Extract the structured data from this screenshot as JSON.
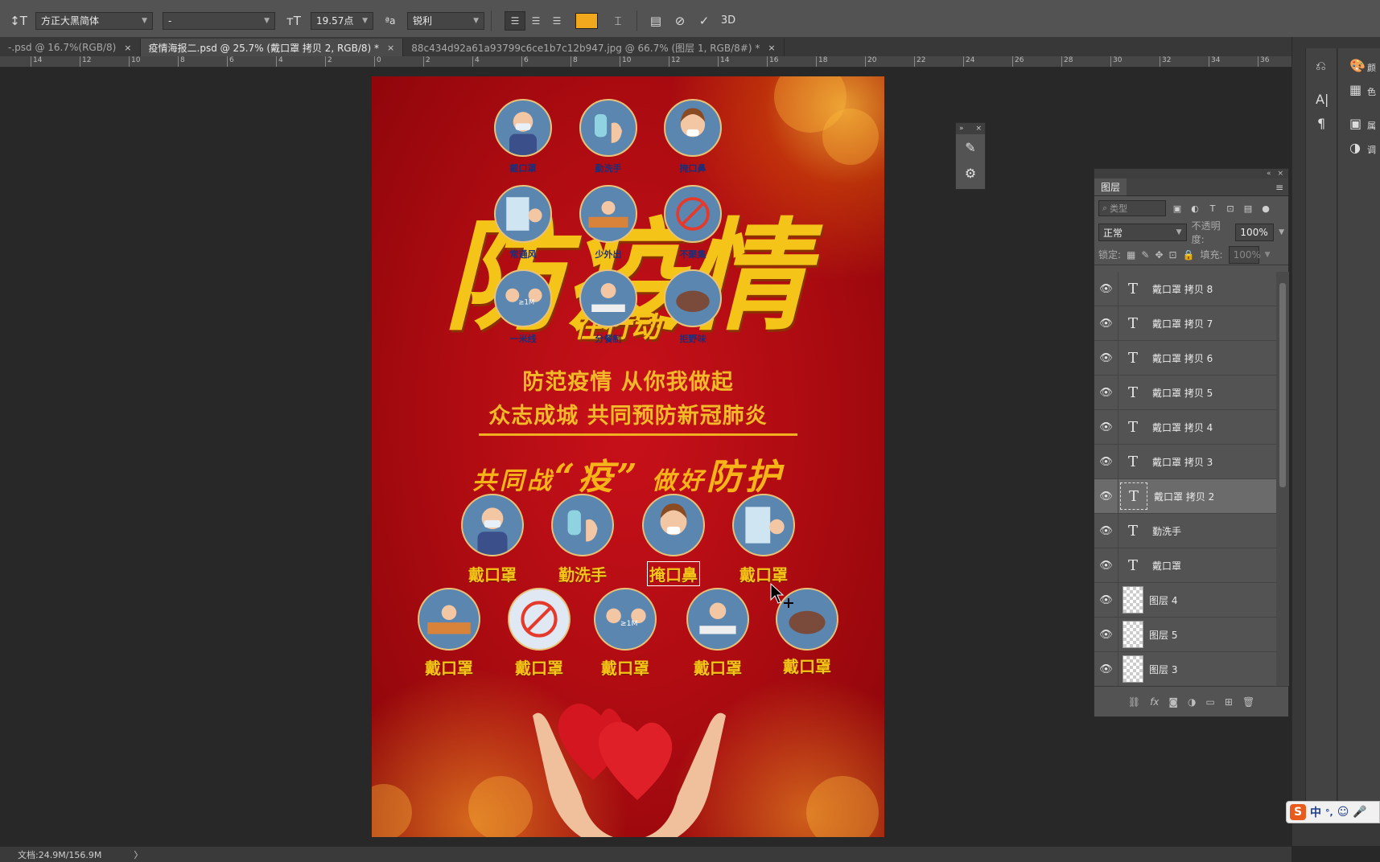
{
  "options_bar": {
    "font_family": "方正大黑简体",
    "font_style": "-",
    "font_size": "19.57点",
    "antialias": "锐利",
    "text_color": "#f2a81d",
    "icons": [
      "text-orientation-icon",
      "font-size-icon",
      "antialias-icon",
      "align-left-icon",
      "align-center-icon",
      "align-right-icon",
      "warp-text-icon",
      "panels-icon",
      "cancel-icon",
      "commit-icon",
      "3d-icon"
    ],
    "threed_label": "3D"
  },
  "tabs": [
    {
      "label": "-.psd @ 16.7%(RGB/8)",
      "close": "×"
    },
    {
      "label": "疫情海报二.psd @ 25.7% (戴口罩 拷贝 2, RGB/8) *",
      "close": "×"
    },
    {
      "label": "88c434d92a61a93799c6ce1b7c12b947.jpg @ 66.7% (图层 1, RGB/8#) *",
      "close": "×"
    }
  ],
  "ruler_ticks": [
    "14",
    "12",
    "10",
    "8",
    "6",
    "4",
    "2",
    "0",
    "2",
    "4",
    "6",
    "8",
    "10",
    "12",
    "14",
    "16",
    "18",
    "20",
    "22",
    "24",
    "26",
    "28",
    "30",
    "32",
    "34",
    "36"
  ],
  "poster": {
    "top_icons": [
      {
        "caption": "戴口罩",
        "icon": "mask-person-icon"
      },
      {
        "caption": "勤洗手",
        "icon": "hand-washing-icon"
      },
      {
        "caption": "掩口鼻",
        "icon": "cover-mouth-icon"
      },
      {
        "caption": "常通风",
        "icon": "window-icon"
      },
      {
        "caption": "少外出",
        "icon": "stay-home-icon"
      },
      {
        "caption": "不聚集",
        "icon": "no-gathering-icon"
      },
      {
        "caption": "一米线",
        "icon": "one-meter-icon"
      },
      {
        "caption": "分餐制",
        "icon": "separate-meal-icon"
      },
      {
        "caption": "拒野味",
        "icon": "pangolin-icon"
      }
    ],
    "title_calligraphy": "防疫情",
    "title_sub": "在行动",
    "line1": "防范疫情  从你我做起",
    "line2": "众志成城 共同预防新冠肺炎",
    "slogan_a": "共同战",
    "slogan_quote_open": "“",
    "slogan_big": "疫",
    "slogan_quote_close": "”",
    "slogan_b": "做好",
    "slogan_c": "防护",
    "row1": [
      "戴口罩",
      "勤洗手",
      "掩口鼻",
      "戴口罩"
    ],
    "row2": [
      "戴口罩",
      "戴口罩",
      "戴口罩",
      "戴口罩",
      "戴口罩"
    ]
  },
  "layers_panel": {
    "tab": "图层",
    "search_placeholder": "类型",
    "blend_mode": "正常",
    "opacity_label": "不透明度:",
    "opacity_value": "100%",
    "lock_label": "锁定:",
    "fill_label": "填充:",
    "fill_value": "100%",
    "layers": [
      {
        "name": "戴口罩 拷贝 8",
        "kind": "text"
      },
      {
        "name": "戴口罩 拷贝 7",
        "kind": "text"
      },
      {
        "name": "戴口罩 拷贝 6",
        "kind": "text"
      },
      {
        "name": "戴口罩 拷贝 5",
        "kind": "text"
      },
      {
        "name": "戴口罩 拷贝 4",
        "kind": "text"
      },
      {
        "name": "戴口罩 拷贝 3",
        "kind": "text"
      },
      {
        "name": "戴口罩 拷贝 2",
        "kind": "text",
        "selected": true
      },
      {
        "name": "勤洗手",
        "kind": "text"
      },
      {
        "name": "戴口罩",
        "kind": "text"
      },
      {
        "name": "图层 4",
        "kind": "pixel"
      },
      {
        "name": "图层 5",
        "kind": "pixel"
      },
      {
        "name": "图层 3",
        "kind": "pixel"
      }
    ]
  },
  "right_dock": {
    "items": [
      "颜",
      "色",
      "属",
      "调"
    ]
  },
  "status_bar": {
    "doc_info": "文档:24.9M/156.9M",
    "chevron": "〉"
  },
  "ime": {
    "logo": "S",
    "lang": "中",
    "punct": "°,"
  }
}
